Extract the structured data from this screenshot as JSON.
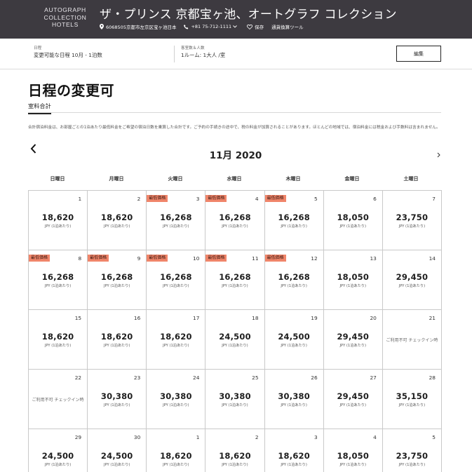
{
  "header": {
    "logo_lines": [
      "AUTOGRAPH",
      "COLLECTION",
      "HOTELS"
    ],
    "hotel_name": "ザ・プリンス 京都宝ヶ池、オートグラフ コレクション",
    "address": "6068505京都市左京区宝ヶ池日本",
    "phone": "+81 75-712-1111",
    "save_label": "保存",
    "currency_tool": "通貨換算ツール"
  },
  "search_bar": {
    "date_label": "日程",
    "date_value": "変更可能な日程 10月 - 1泊数",
    "guests_label": "客室数＆人数",
    "guests_value": "1ルーム: 1大人 /室",
    "edit_label": "編集"
  },
  "page_title": "日程の変更可",
  "tab_label": "室料合計",
  "note": "合計宿泊料金は、お部屋ごとの1泊あたり最低料金をご希望の宿泊日数を乗算した合計です。ご予約の手続きの途中で、税の料金が加算されることがあります。ほとんどの地域では、宿泊料金には税金および手数料は含まれません。",
  "calendar": {
    "month_label": "11月 2020",
    "weekdays": [
      "日曜日",
      "月曜日",
      "火曜日",
      "水曜日",
      "木曜日",
      "金曜日",
      "土曜日"
    ],
    "lowest_badge": "最低価格",
    "per_night": "JPY (1泊あたり)",
    "unavailable_text": "ご利用不可 チェックイン時",
    "days": [
      {
        "day": "1",
        "price": "18,620",
        "lowest": false
      },
      {
        "day": "2",
        "price": "18,620",
        "lowest": false
      },
      {
        "day": "3",
        "price": "16,268",
        "lowest": true
      },
      {
        "day": "4",
        "price": "16,268",
        "lowest": true
      },
      {
        "day": "5",
        "price": "16,268",
        "lowest": true
      },
      {
        "day": "6",
        "price": "18,050",
        "lowest": false
      },
      {
        "day": "7",
        "price": "23,750",
        "lowest": false
      },
      {
        "day": "8",
        "price": "16,268",
        "lowest": true
      },
      {
        "day": "9",
        "price": "16,268",
        "lowest": true
      },
      {
        "day": "10",
        "price": "16,268",
        "lowest": true
      },
      {
        "day": "11",
        "price": "16,268",
        "lowest": true
      },
      {
        "day": "12",
        "price": "16,268",
        "lowest": true
      },
      {
        "day": "13",
        "price": "18,050",
        "lowest": false
      },
      {
        "day": "14",
        "price": "29,450",
        "lowest": false
      },
      {
        "day": "15",
        "price": "18,620",
        "lowest": false
      },
      {
        "day": "16",
        "price": "18,620",
        "lowest": false
      },
      {
        "day": "17",
        "price": "18,620",
        "lowest": false
      },
      {
        "day": "18",
        "price": "24,500",
        "lowest": false
      },
      {
        "day": "19",
        "price": "24,500",
        "lowest": false
      },
      {
        "day": "20",
        "price": "29,450",
        "lowest": false
      },
      {
        "day": "21",
        "price": null,
        "lowest": false
      },
      {
        "day": "22",
        "price": null,
        "lowest": false
      },
      {
        "day": "23",
        "price": "30,380",
        "lowest": false
      },
      {
        "day": "24",
        "price": "30,380",
        "lowest": false
      },
      {
        "day": "25",
        "price": "30,380",
        "lowest": false
      },
      {
        "day": "26",
        "price": "30,380",
        "lowest": false
      },
      {
        "day": "27",
        "price": "29,450",
        "lowest": false
      },
      {
        "day": "28",
        "price": "35,150",
        "lowest": false
      },
      {
        "day": "29",
        "price": "24,500",
        "lowest": false
      },
      {
        "day": "30",
        "price": "24,500",
        "lowest": false
      },
      {
        "day": "1",
        "price": "18,620",
        "lowest": false
      },
      {
        "day": "2",
        "price": "18,620",
        "lowest": false
      },
      {
        "day": "3",
        "price": "18,620",
        "lowest": false
      },
      {
        "day": "4",
        "price": "18,050",
        "lowest": false
      },
      {
        "day": "5",
        "price": "23,750",
        "lowest": false
      }
    ]
  },
  "colors": {
    "header_bg": "#3d3a40",
    "badge_bg": "#f0856a"
  }
}
